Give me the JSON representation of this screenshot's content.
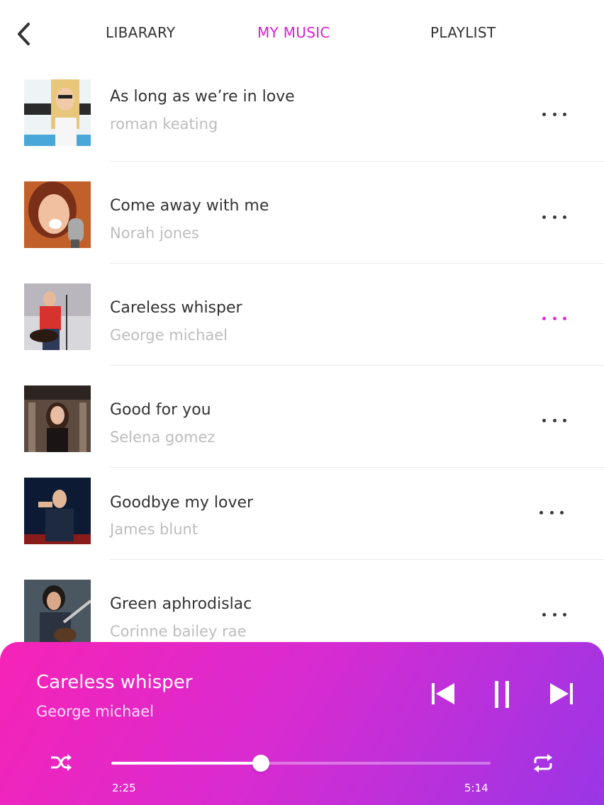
{
  "header": {
    "back_icon": "chevron-left-icon",
    "tabs": [
      {
        "label": "LIBARARY",
        "active": false
      },
      {
        "label": "MY MUSIC",
        "active": true
      },
      {
        "label": "PLAYLIST",
        "active": false
      }
    ]
  },
  "songs": [
    {
      "title": "As long as we’re in love",
      "artist": "roman keating",
      "more_icon": "more-horizontal-icon",
      "active": false
    },
    {
      "title": "Come away with me",
      "artist": "Norah jones",
      "more_icon": "more-horizontal-icon",
      "active": false
    },
    {
      "title": "Careless whisper",
      "artist": "George michael",
      "more_icon": "more-horizontal-icon",
      "active": true
    },
    {
      "title": "Good for you",
      "artist": "Selena gomez",
      "more_icon": "more-horizontal-icon",
      "active": false
    },
    {
      "title": "Goodbye my lover",
      "artist": "James blunt",
      "more_icon": "more-horizontal-icon",
      "active": false
    },
    {
      "title": "Green aphrodislac",
      "artist": "Corinne bailey rae",
      "more_icon": "more-horizontal-icon",
      "active": false
    }
  ],
  "player": {
    "title": "Careless whisper",
    "artist": "George michael",
    "elapsed": "2:25",
    "duration": "5:14",
    "progress": 0.395,
    "icons": {
      "previous": "skip-previous-icon",
      "pause": "pause-icon",
      "next": "skip-next-icon",
      "shuffle": "shuffle-icon",
      "repeat": "repeat-icon"
    }
  },
  "colors": {
    "accent": "#d61fd2",
    "gradient_start": "#f623b6",
    "gradient_end": "#9a36e6",
    "title_text": "#333333",
    "artist_text": "#bdbdbd"
  }
}
